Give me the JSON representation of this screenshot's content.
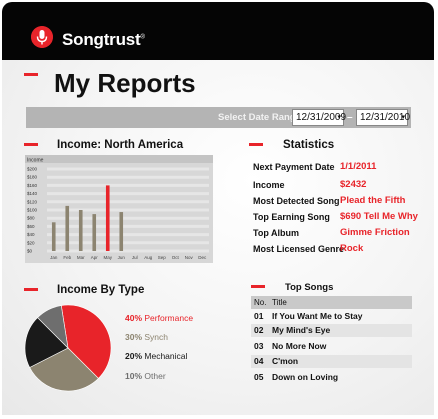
{
  "brand": {
    "name": "Songtrust",
    "reg_mark": "®"
  },
  "page": {
    "title": "My Reports"
  },
  "date_range": {
    "label": "Select Date Range:",
    "start": "12/31/2009",
    "end": "12/31/2010",
    "separator": "–"
  },
  "income_region": {
    "title": "Income: North America",
    "chart_data": {
      "type": "bar",
      "title": "Income",
      "categories": [
        "Jan",
        "Feb",
        "Mar",
        "Apr",
        "May",
        "Jun",
        "Jul",
        "Aug",
        "Sep",
        "Oct",
        "Nov",
        "Dec"
      ],
      "values": [
        70,
        110,
        100,
        90,
        160,
        95,
        0,
        0,
        0,
        0,
        0,
        0
      ],
      "highlight_index": 4,
      "y_ticks": [
        "$200",
        "$180",
        "$160",
        "$140",
        "$120",
        "$100",
        "$80",
        "$60",
        "$40",
        "$20",
        "$0"
      ],
      "ylim": [
        0,
        200
      ],
      "bar_color": "#8c8470",
      "highlight_color": "#e8242a"
    }
  },
  "statistics": {
    "title": "Statistics",
    "items": [
      {
        "label": "Next Payment Date",
        "value": "1/1/2011"
      },
      {
        "label": "Income",
        "value": "$2432"
      },
      {
        "label": "Most Detected Song",
        "value": "Plead the Fifth"
      },
      {
        "label": "Top Earning Song",
        "value": "$690 Tell Me Why"
      },
      {
        "label": "Top Album",
        "value": "Gimme Friction"
      },
      {
        "label": "Most Licensed Genre",
        "value": "Rock"
      }
    ]
  },
  "income_by_type": {
    "title": "Income By Type",
    "chart_data": {
      "type": "pie",
      "slices": [
        {
          "name": "Performance",
          "percent": 40,
          "label": "40%",
          "color": "#e8242a"
        },
        {
          "name": "Synch",
          "percent": 30,
          "label": "30%",
          "color": "#8c8470"
        },
        {
          "name": "Mechanical",
          "percent": 20,
          "label": "20%",
          "color": "#1a1a1a"
        },
        {
          "name": "Other",
          "percent": 10,
          "label": "10%",
          "color": "#6e6e6e"
        }
      ]
    }
  },
  "top_songs": {
    "title": "Top Songs",
    "columns": [
      "No.",
      "Title"
    ],
    "rows": [
      {
        "no": "01",
        "title": "If You Want Me to Stay"
      },
      {
        "no": "02",
        "title": "My Mind's Eye"
      },
      {
        "no": "03",
        "title": "No More Now"
      },
      {
        "no": "04",
        "title": "C'mon"
      },
      {
        "no": "05",
        "title": "Down on Loving"
      }
    ]
  }
}
